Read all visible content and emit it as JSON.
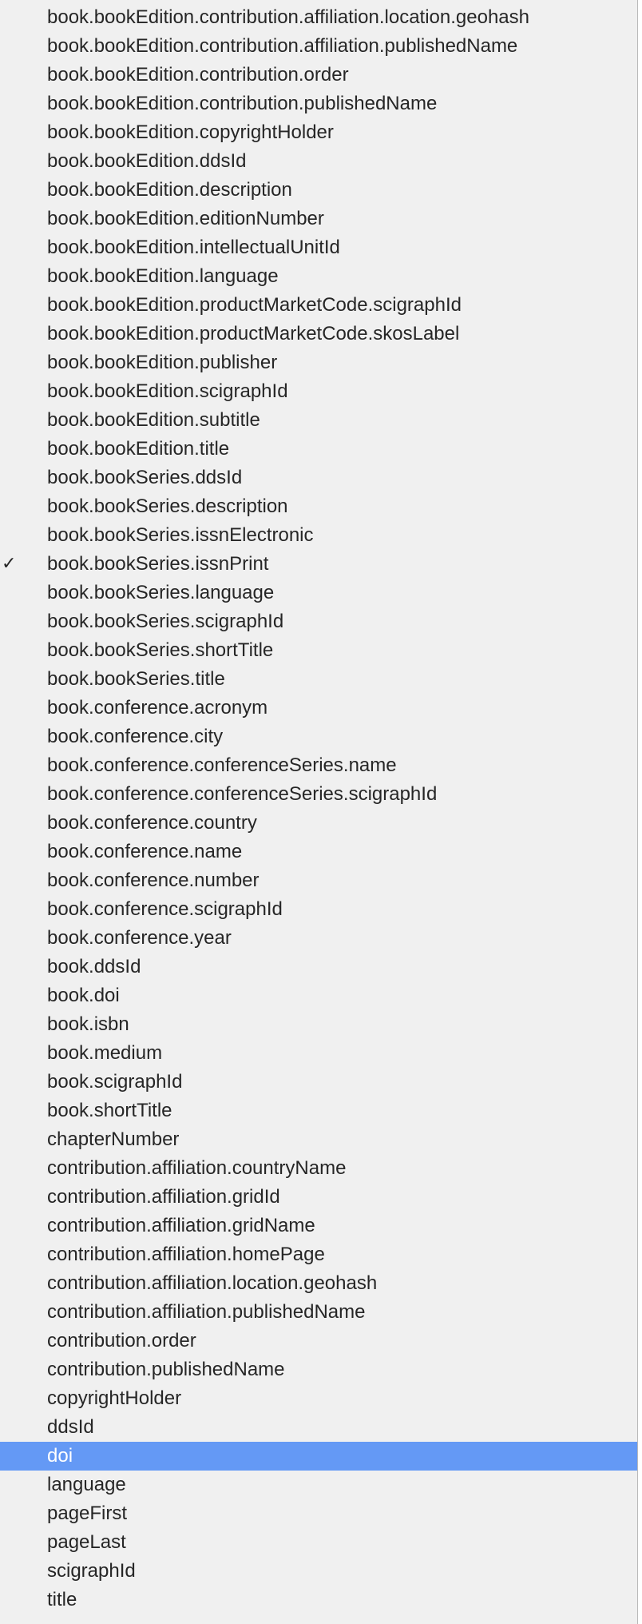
{
  "menu": {
    "items": [
      {
        "label": "book.bookEdition.contribution.affiliation.location.geohash"
      },
      {
        "label": "book.bookEdition.contribution.affiliation.publishedName"
      },
      {
        "label": "book.bookEdition.contribution.order"
      },
      {
        "label": "book.bookEdition.contribution.publishedName"
      },
      {
        "label": "book.bookEdition.copyrightHolder"
      },
      {
        "label": "book.bookEdition.ddsId"
      },
      {
        "label": "book.bookEdition.description"
      },
      {
        "label": "book.bookEdition.editionNumber"
      },
      {
        "label": "book.bookEdition.intellectualUnitId"
      },
      {
        "label": "book.bookEdition.language"
      },
      {
        "label": "book.bookEdition.productMarketCode.scigraphId"
      },
      {
        "label": "book.bookEdition.productMarketCode.skosLabel"
      },
      {
        "label": "book.bookEdition.publisher"
      },
      {
        "label": "book.bookEdition.scigraphId"
      },
      {
        "label": "book.bookEdition.subtitle"
      },
      {
        "label": "book.bookEdition.title"
      },
      {
        "label": "book.bookSeries.ddsId"
      },
      {
        "label": "book.bookSeries.description"
      },
      {
        "label": "book.bookSeries.issnElectronic"
      },
      {
        "label": "book.bookSeries.issnPrint",
        "check": "✓"
      },
      {
        "label": "book.bookSeries.language"
      },
      {
        "label": "book.bookSeries.scigraphId"
      },
      {
        "label": "book.bookSeries.shortTitle"
      },
      {
        "label": "book.bookSeries.title"
      },
      {
        "label": "book.conference.acronym"
      },
      {
        "label": "book.conference.city"
      },
      {
        "label": "book.conference.conferenceSeries.name"
      },
      {
        "label": "book.conference.conferenceSeries.scigraphId"
      },
      {
        "label": "book.conference.country"
      },
      {
        "label": "book.conference.name"
      },
      {
        "label": "book.conference.number"
      },
      {
        "label": "book.conference.scigraphId"
      },
      {
        "label": "book.conference.year"
      },
      {
        "label": "book.ddsId"
      },
      {
        "label": "book.doi"
      },
      {
        "label": "book.isbn"
      },
      {
        "label": "book.medium"
      },
      {
        "label": "book.scigraphId"
      },
      {
        "label": "book.shortTitle"
      },
      {
        "label": "chapterNumber"
      },
      {
        "label": "contribution.affiliation.countryName"
      },
      {
        "label": "contribution.affiliation.gridId"
      },
      {
        "label": "contribution.affiliation.gridName"
      },
      {
        "label": "contribution.affiliation.homePage"
      },
      {
        "label": "contribution.affiliation.location.geohash"
      },
      {
        "label": "contribution.affiliation.publishedName"
      },
      {
        "label": "contribution.order"
      },
      {
        "label": "contribution.publishedName"
      },
      {
        "label": "copyrightHolder"
      },
      {
        "label": "ddsId"
      },
      {
        "label": "doi",
        "selected": true
      },
      {
        "label": "language"
      },
      {
        "label": "pageFirst"
      },
      {
        "label": "pageLast"
      },
      {
        "label": "scigraphId"
      },
      {
        "label": "title"
      }
    ]
  },
  "colors": {
    "menu_background": "#f0f0f0",
    "selection_highlight": "#6499f5",
    "text": "#262626",
    "selected_text": "#ffffff"
  }
}
